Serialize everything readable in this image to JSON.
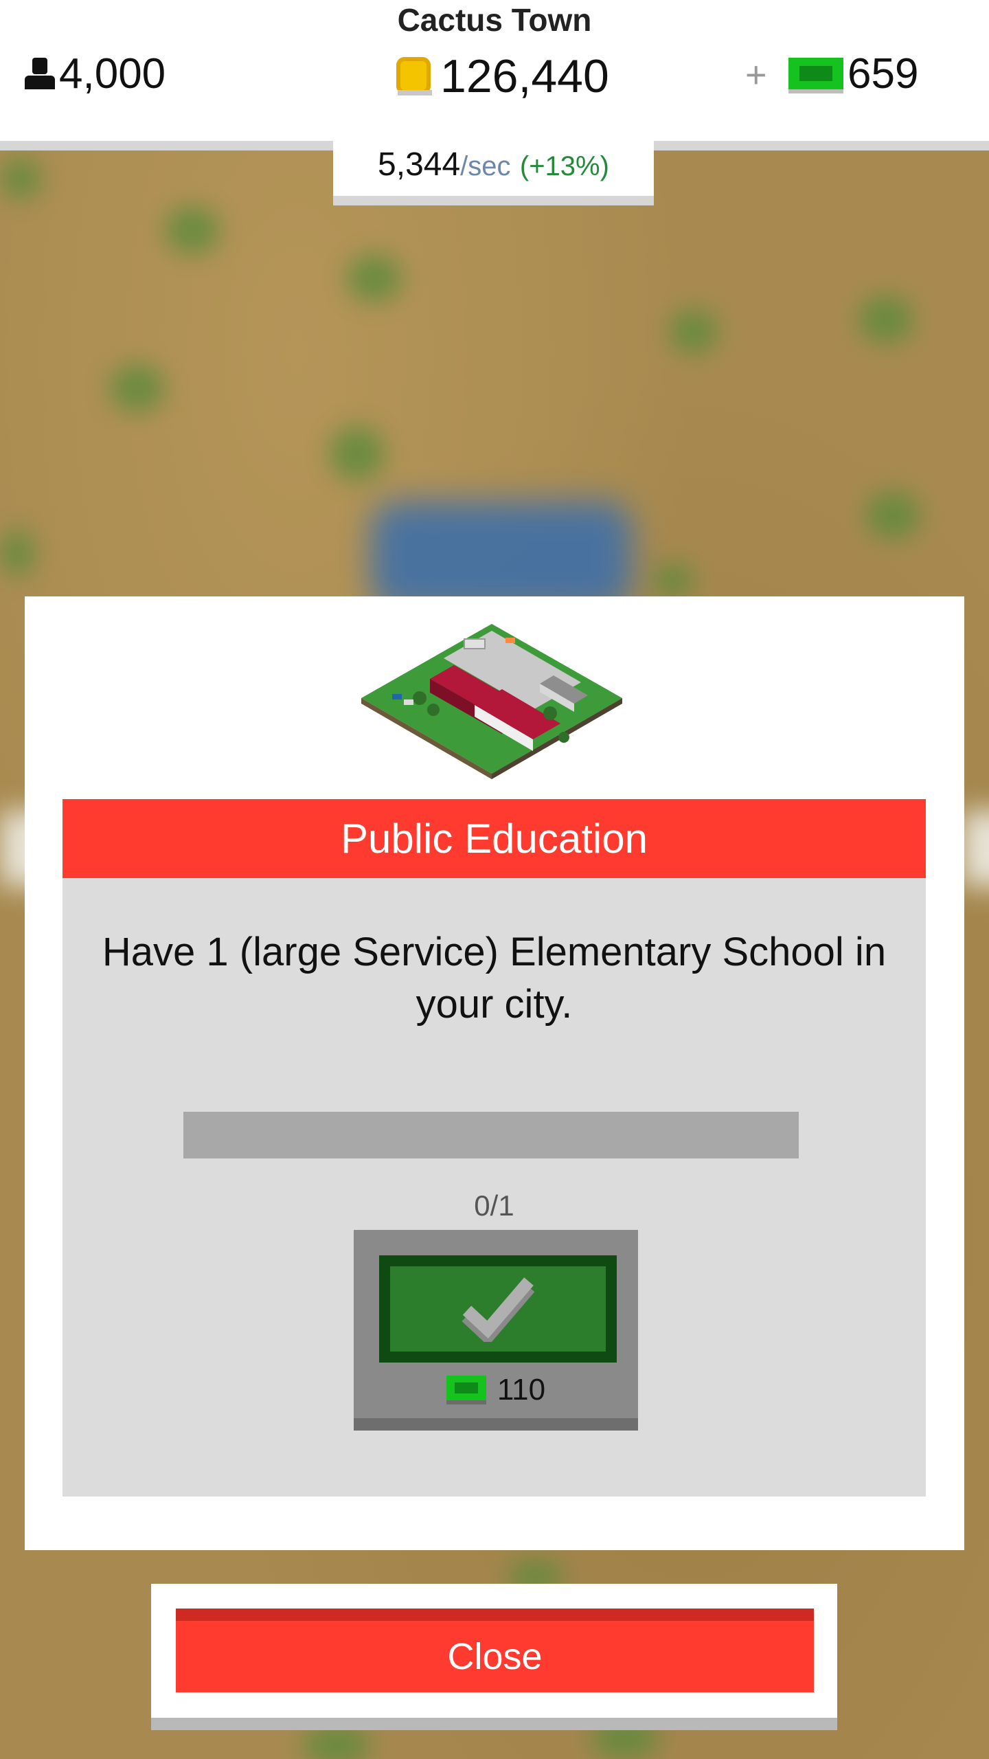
{
  "header": {
    "city_name": "Cactus Town",
    "population": "4,000",
    "coins": "126,440",
    "plus_label": "+",
    "gems": "659",
    "rate_value": "5,344",
    "rate_unit": "/sec",
    "rate_bonus": "(+13%)"
  },
  "dialog": {
    "image": "elementary-school-building",
    "title": "Public Education",
    "description": "Have 1 (large Service) Elementary School in your city.",
    "progress": {
      "current": 0,
      "target": 1,
      "fraction": 0.0
    },
    "progress_text": "0/1",
    "reward_icon": "checkmark-icon",
    "reward_cost": "110"
  },
  "close_label": "Close",
  "colors": {
    "accent_red": "#ff3b2f",
    "gem_green": "#16c21e",
    "claim_green": "#2c7d2c",
    "bonus_green": "#238a3a"
  }
}
